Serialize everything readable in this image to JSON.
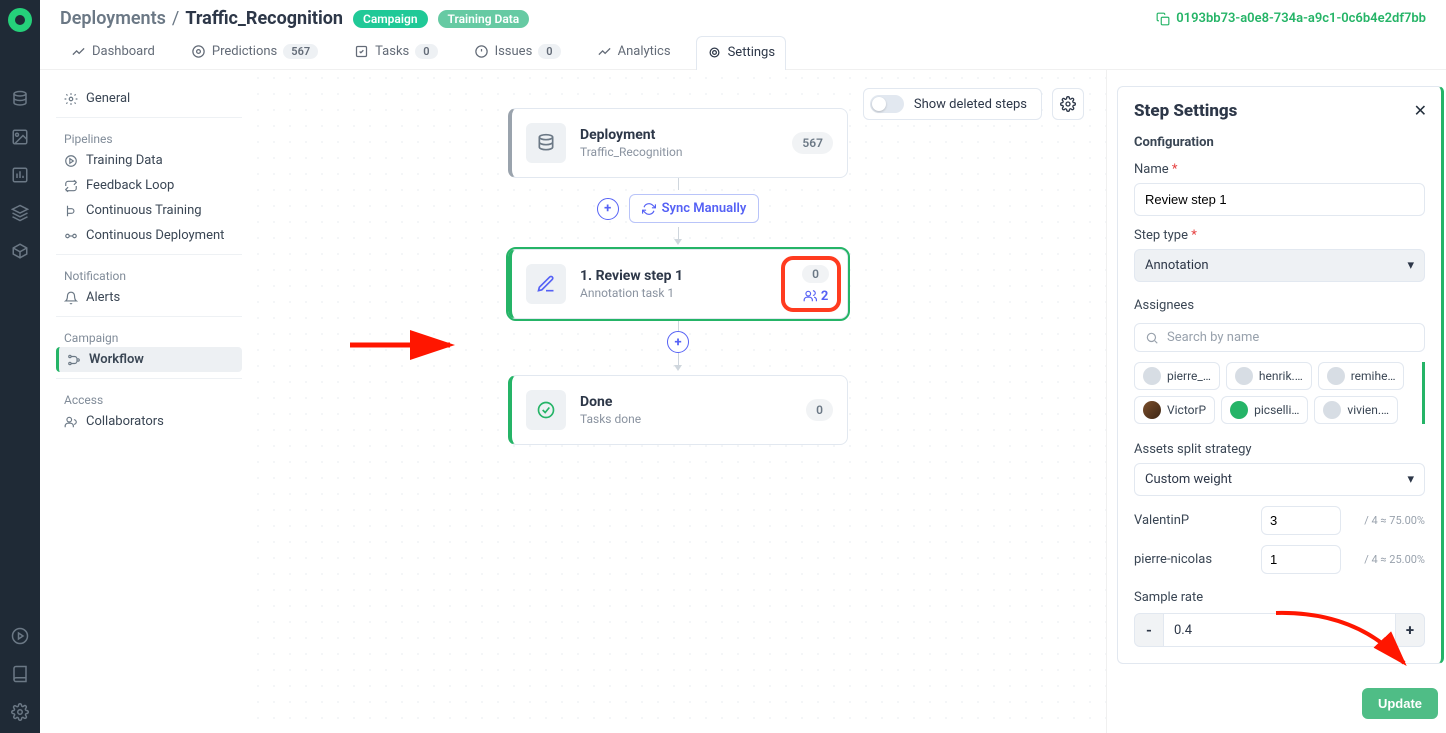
{
  "breadcrumb": {
    "root": "Deployments",
    "leaf": "Traffic_Recognition"
  },
  "badges": {
    "campaign": "Campaign",
    "training_data": "Training Data"
  },
  "header_id": "0193bb73-a0e8-734a-a9c1-0c6b4e2df7bb",
  "tabs": {
    "dashboard": "Dashboard",
    "predictions": "Predictions",
    "predictions_count": "567",
    "tasks": "Tasks",
    "tasks_count": "0",
    "issues": "Issues",
    "issues_count": "0",
    "analytics": "Analytics",
    "settings": "Settings"
  },
  "sidebar": {
    "general": "General",
    "pipelines_label": "Pipelines",
    "training_data": "Training Data",
    "feedback_loop": "Feedback Loop",
    "continuous_training": "Continuous Training",
    "continuous_deployment": "Continuous Deployment",
    "notification_label": "Notification",
    "alerts": "Alerts",
    "campaign_label": "Campaign",
    "workflow": "Workflow",
    "access_label": "Access",
    "collaborators": "Collaborators"
  },
  "canvas": {
    "show_deleted": "Show deleted steps",
    "sync": "Sync Manually",
    "deploy_title": "Deployment",
    "deploy_sub": "Traffic_Recognition",
    "deploy_count": "567",
    "review_title": "1. Review step 1",
    "review_sub": "Annotation task 1",
    "review_count": "0",
    "review_assignees": "2",
    "done_title": "Done",
    "done_sub": "Tasks done",
    "done_count": "0"
  },
  "panel": {
    "title": "Step Settings",
    "config": "Configuration",
    "name_label": "Name",
    "name_value": "Review step 1",
    "type_label": "Step type",
    "type_value": "Annotation",
    "assignees_label": "Assignees",
    "search_placeholder": "Search by name",
    "chips": {
      "a": "pierre_…",
      "b": "henrik.…",
      "c": "remihe…",
      "d": "VictorP",
      "e": "picselli…",
      "f": "vivien.…"
    },
    "split_label": "Assets split strategy",
    "split_value": "Custom weight",
    "splits": {
      "a_name": "ValentinP",
      "a_val": "3",
      "a_calc": "/ 4 ≈ 75.00%",
      "b_name": "pierre-nicolas",
      "b_val": "1",
      "b_calc": "/ 4 ≈ 25.00%"
    },
    "sample_label": "Sample rate",
    "sample_val": "0.4",
    "minus": "-",
    "plus": "+",
    "update": "Update"
  }
}
